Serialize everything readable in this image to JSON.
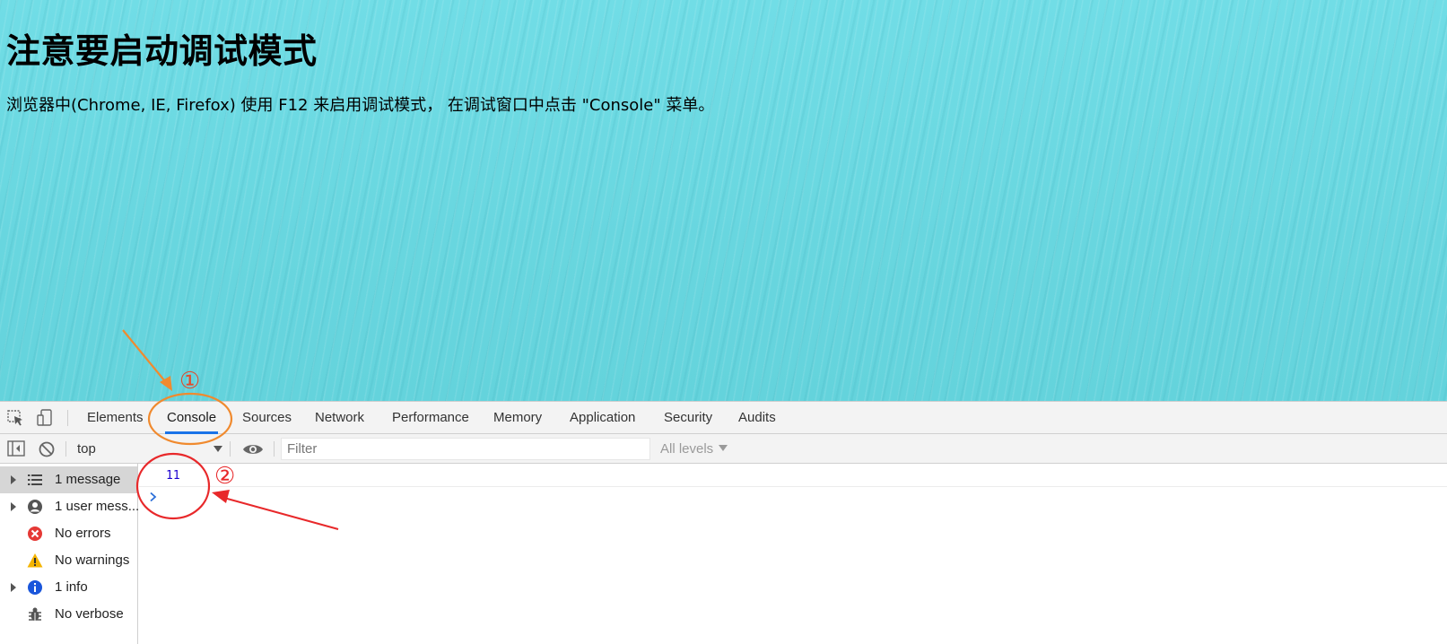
{
  "page": {
    "heading": "注意要启动调试模式",
    "paragraph": "浏览器中(Chrome, IE, Firefox) 使用 F12 来启用调试模式， 在调试窗口中点击 \"Console\" 菜单。"
  },
  "devtools": {
    "tabs": [
      "Elements",
      "Console",
      "Sources",
      "Network",
      "Performance",
      "Memory",
      "Application",
      "Security",
      "Audits"
    ],
    "active_tab": "Console",
    "toolbar": {
      "context": "top",
      "filter_placeholder": "Filter",
      "levels": "All levels"
    },
    "sidebar": [
      {
        "label": "1 message",
        "icon": "list-icon",
        "expandable": true,
        "selected": true
      },
      {
        "label": "1 user mess...",
        "icon": "user-icon",
        "expandable": true,
        "selected": false
      },
      {
        "label": "No errors",
        "icon": "error-icon",
        "expandable": false,
        "selected": false
      },
      {
        "label": "No warnings",
        "icon": "warning-icon",
        "expandable": false,
        "selected": false
      },
      {
        "label": "1 info",
        "icon": "info-icon",
        "expandable": true,
        "selected": false
      },
      {
        "label": "No verbose",
        "icon": "bug-icon",
        "expandable": false,
        "selected": false
      }
    ],
    "console": {
      "messages": [
        "11"
      ]
    }
  },
  "annotations": {
    "marker_1": "①",
    "marker_2": "②",
    "marker_1_color": "#f08a2e",
    "marker_2_color": "#e8282a"
  },
  "colors": {
    "page_background": "#6bd9e2",
    "active_tab_underline": "#1a73e8",
    "console_value": "#1c00cf",
    "error": "#e53935",
    "warning": "#f4b400",
    "info": "#1a56db"
  }
}
